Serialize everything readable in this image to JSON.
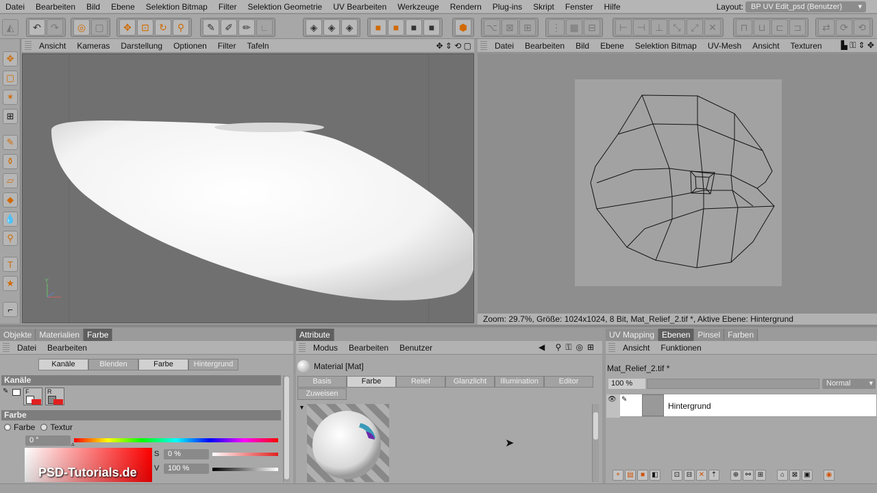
{
  "menubar": {
    "items": [
      "Datei",
      "Bearbeiten",
      "Bild",
      "Ebene",
      "Selektion Bitmap",
      "Filter",
      "Selektion Geometrie",
      "UV Bearbeiten",
      "Werkzeuge",
      "Rendern",
      "Plug-ins",
      "Skript",
      "Fenster",
      "Hilfe"
    ],
    "layout_label": "Layout:",
    "layout_value": "BP UV Edit_psd (Benutzer)"
  },
  "viewport": {
    "menu": [
      "Ansicht",
      "Kameras",
      "Darstellung",
      "Optionen",
      "Filter",
      "Tafeln"
    ],
    "axis_y": "Y"
  },
  "uv_view": {
    "menu": [
      "Datei",
      "Bearbeiten",
      "Bild",
      "Ebene",
      "Selektion Bitmap",
      "UV-Mesh",
      "Ansicht",
      "Texturen"
    ],
    "status": "Zoom: 29.7%, Größe: 1024x1024, 8 Bit, Mat_Relief_2.tif *, Aktive Ebene: Hintergrund"
  },
  "left_panel": {
    "tabs": [
      "Objekte",
      "Materialien",
      "Farbe"
    ],
    "active_tab": "Farbe",
    "menu": [
      "Datei",
      "Bearbeiten"
    ],
    "subtabs": [
      "Kanäle",
      "Blenden",
      "Farbe",
      "Hintergrund"
    ],
    "section_channels": "Kanäle",
    "ch_f": "F",
    "ch_r": "R",
    "section_color": "Farbe",
    "radio_color": "Farbe",
    "radio_texture": "Textur",
    "hue_value": "0 °",
    "s_label": "S",
    "s_value": "0 %",
    "v_label": "V",
    "v_value": "100 %",
    "watermark": "PSD-Tutorials.de"
  },
  "attr_panel": {
    "tab": "Attribute",
    "menu": [
      "Modus",
      "Bearbeiten",
      "Benutzer"
    ],
    "material_title": "Material [Mat]",
    "subtabs_row1": [
      "Basis",
      "Farbe",
      "Relief",
      "Glanzlicht",
      "Illumination",
      "Editor"
    ],
    "subtabs_row2": [
      "Zuweisen"
    ],
    "active_subtab": "Farbe"
  },
  "layers_panel": {
    "tabs": [
      "UV Mapping",
      "Ebenen",
      "Pinsel",
      "Farben"
    ],
    "active_tab": "Ebenen",
    "menu": [
      "Ansicht",
      "Funktionen"
    ],
    "file_name": "Mat_Relief_2.tif *",
    "opacity": "100 %",
    "blend_mode": "Normal",
    "layer_name": "Hintergrund"
  },
  "colors": {
    "accent_orange": "#d06a00",
    "active_tab": "#5f5f5f"
  }
}
